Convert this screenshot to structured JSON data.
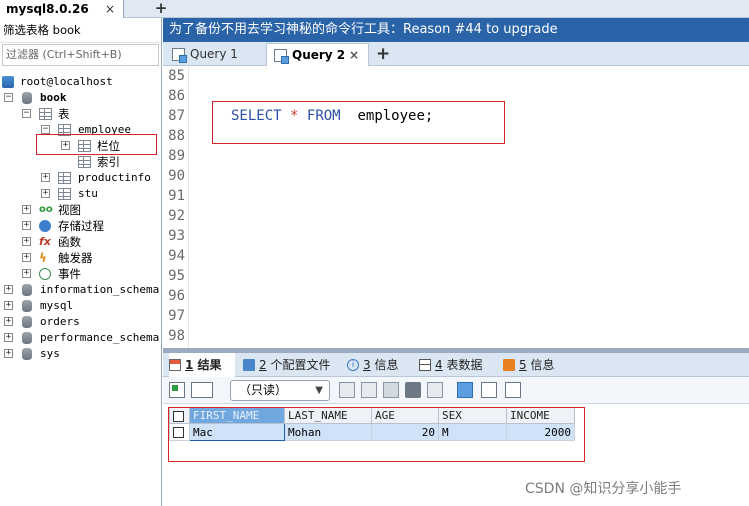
{
  "connection_tab": {
    "label": "mysql8.0.26",
    "close": "×",
    "add": "+"
  },
  "left_panel": {
    "filter_label": "筛选表格 book",
    "filter_placeholder": "过滤器 (Ctrl+Shift+B)",
    "tree": {
      "root": "root@localhost",
      "book": "book",
      "tables_folder": "表",
      "employee": "employee",
      "columns": "栏位",
      "indexes": "索引",
      "productinfo": "productinfo",
      "stu": "stu",
      "views": "视图",
      "procedures": "存储过程",
      "functions": "函数",
      "triggers": "触发器",
      "events": "事件",
      "databases": [
        "information_schema",
        "mysql",
        "orders",
        "performance_schema",
        "sys"
      ]
    }
  },
  "query_title": "为了备份不用去学习神秘的命令行工具：Reason #44 to upgrade",
  "query_tabs": [
    {
      "label": "Query 1",
      "active": false
    },
    {
      "label": "Query 2",
      "active": true
    }
  ],
  "query_tab_close": "×",
  "query_tab_add": "+",
  "editor": {
    "line_numbers": [
      "85",
      "86",
      "87",
      "88",
      "89",
      "90",
      "91",
      "92",
      "93",
      "94",
      "95",
      "96",
      "97",
      "98"
    ],
    "code": {
      "kw1": "SELECT",
      "star": "*",
      "kw2": "FROM",
      "table": "employee;"
    }
  },
  "result_tabs": [
    {
      "num": "1",
      "label": "结果"
    },
    {
      "num": "2",
      "label": "个配置文件"
    },
    {
      "num": "3",
      "label": "信息"
    },
    {
      "num": "4",
      "label": "表数据"
    },
    {
      "num": "5",
      "label": "信息"
    }
  ],
  "result_toolbar": {
    "mode": "（只读）"
  },
  "result_grid": {
    "columns": [
      "FIRST_NAME",
      "LAST_NAME",
      "AGE",
      "SEX",
      "INCOME"
    ],
    "rows": [
      {
        "FIRST_NAME": "Mac",
        "LAST_NAME": "Mohan",
        "AGE": "20",
        "SEX": "M",
        "INCOME": "2000"
      }
    ]
  },
  "watermark": "CSDN @知识分享小能手",
  "colors": {
    "title_bar": "#2a63a8",
    "highlight_box": "#d9232a",
    "keyword": "#2e4ea8",
    "selected_header": "#6fa7de"
  }
}
